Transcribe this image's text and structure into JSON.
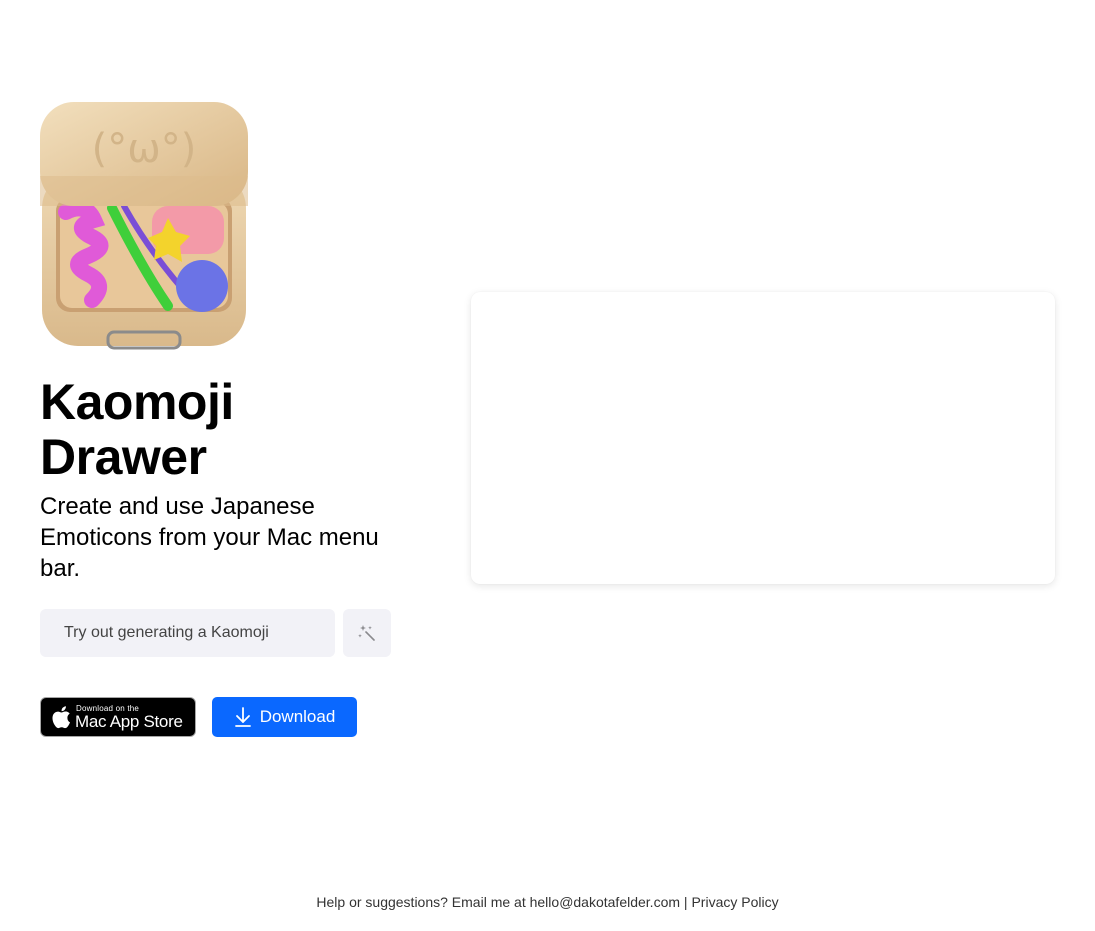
{
  "app": {
    "title": "Kaomoji Drawer",
    "tagline": "Create and use Japanese Emoticons from your Mac menu bar.",
    "icon_face": "(°ω°)"
  },
  "generator": {
    "placeholder": "Try out generating a Kaomoji",
    "button_icon": "magic-wand-icon"
  },
  "badges": {
    "appstore_small": "Download on the",
    "appstore_big": "Mac App Store",
    "download_label": "Download"
  },
  "footer": {
    "help_text": "Help or suggestions? Email me at",
    "email": "hello@dakotafelder.com",
    "separator": "|",
    "privacy": "Privacy Policy"
  },
  "colors": {
    "accent": "#0a68ff",
    "input_bg": "#f2f2f7",
    "badge_bg": "#000000"
  }
}
